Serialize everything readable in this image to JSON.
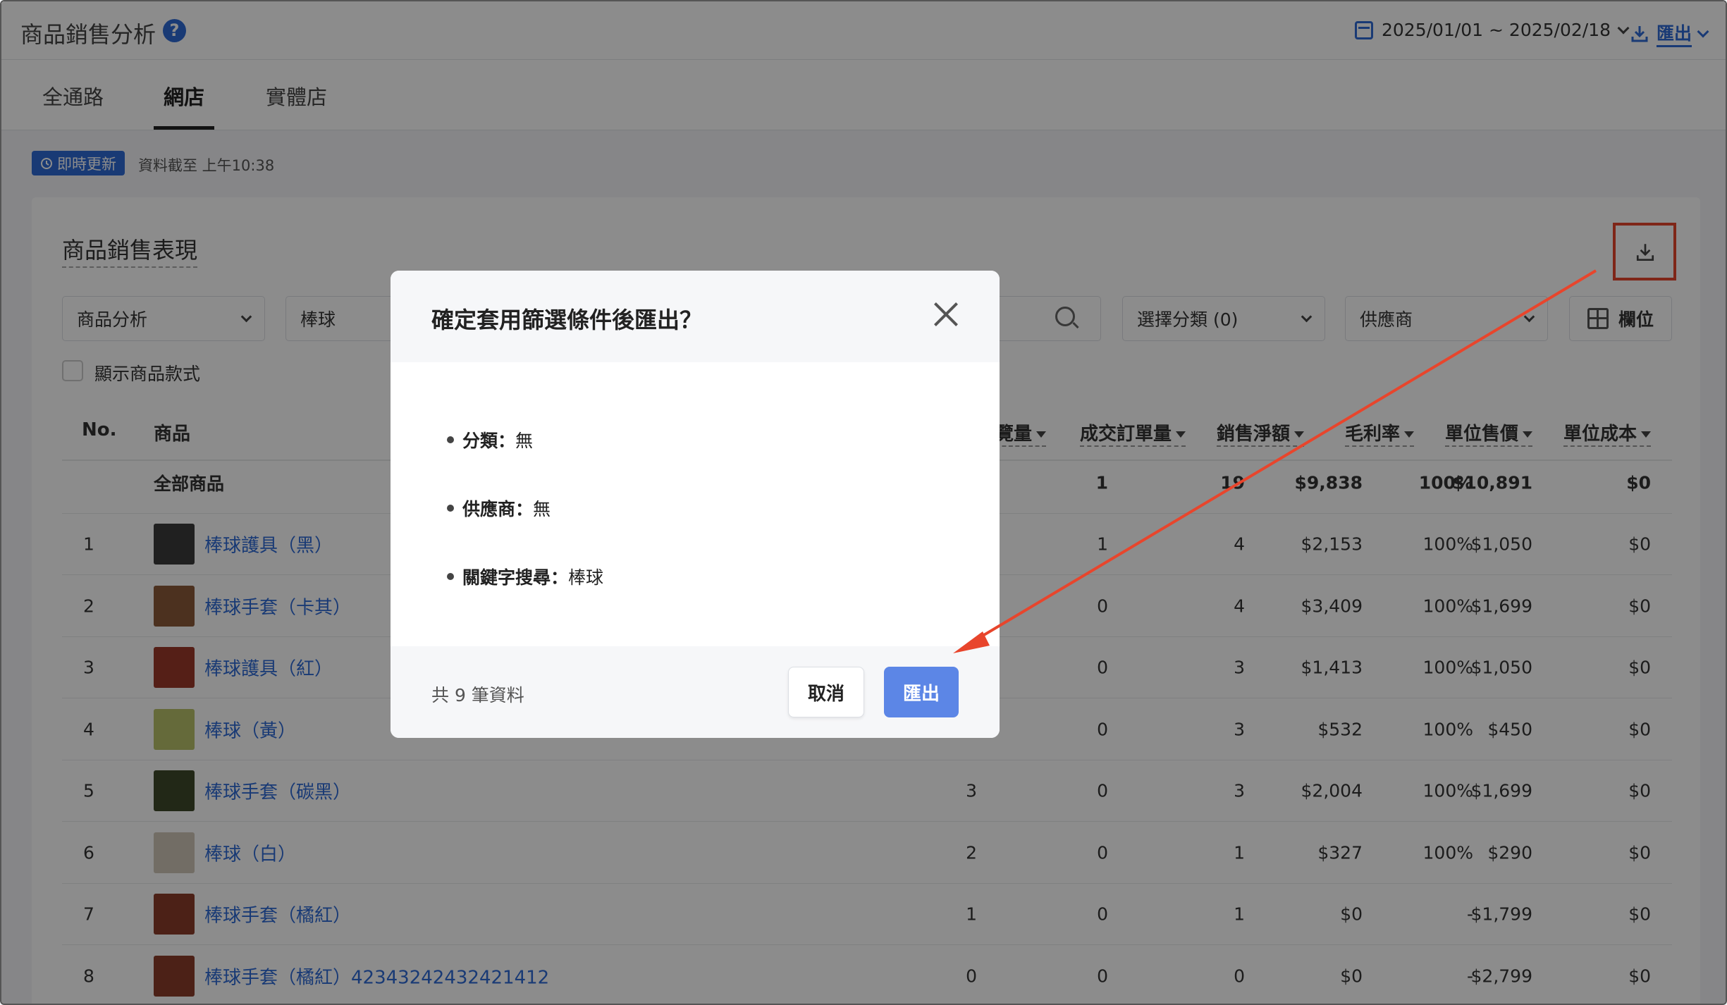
{
  "header": {
    "title": "商品銷售分析",
    "help_icon": "?",
    "date_range": "2025/01/01 ~ 2025/02/18",
    "export_label": "匯出"
  },
  "tabs": [
    {
      "label": "全通路"
    },
    {
      "label": "網店"
    },
    {
      "label": "實體店"
    }
  ],
  "live": {
    "badge": "即時更新",
    "updated_text": "資料截至 上午10:38"
  },
  "card": {
    "title": "商品銷售表現",
    "filters": {
      "analysis_select": "商品分析",
      "keyword_value": "棒球",
      "category_select": "選擇分類 (0)",
      "supplier_select": "供應商",
      "columns_button": "欄位"
    },
    "show_variants_label": "顯示商品款式"
  },
  "table": {
    "headers": {
      "no": "No.",
      "product": "商品",
      "views": "覽量",
      "orders": "成交訂單量",
      "net_sales": "銷售淨額",
      "margin": "毛利率",
      "unit_price": "單位售價",
      "unit_cost": "單位成本"
    },
    "total": {
      "label": "全部商品",
      "views": "1",
      "orders": "19",
      "net_sales": "$9,838",
      "margin": "100%",
      "unit_price": "$10,891",
      "unit_cost": "$0"
    },
    "rows": [
      {
        "no": "1",
        "name": "棒球護具（黑）",
        "a": "",
        "views": "1",
        "orders": "4",
        "net_sales": "$2,153",
        "margin": "100%",
        "unit_price": "$1,050",
        "unit_cost": "$0"
      },
      {
        "no": "2",
        "name": "棒球手套（卡其）",
        "a": "",
        "views": "0",
        "orders": "4",
        "net_sales": "$3,409",
        "margin": "100%",
        "unit_price": "$1,699",
        "unit_cost": "$0"
      },
      {
        "no": "3",
        "name": "棒球護具（紅）",
        "a": "",
        "views": "0",
        "orders": "3",
        "net_sales": "$1,413",
        "margin": "100%",
        "unit_price": "$1,050",
        "unit_cost": "$0"
      },
      {
        "no": "4",
        "name": "棒球（黃）",
        "a": "",
        "views": "0",
        "orders": "3",
        "net_sales": "$532",
        "margin": "100%",
        "unit_price": "$450",
        "unit_cost": "$0"
      },
      {
        "no": "5",
        "name": "棒球手套（碳黑）",
        "a": "3",
        "views": "0",
        "orders": "3",
        "net_sales": "$2,004",
        "margin": "100%",
        "unit_price": "$1,699",
        "unit_cost": "$0"
      },
      {
        "no": "6",
        "name": "棒球（白）",
        "a": "2",
        "views": "0",
        "orders": "1",
        "net_sales": "$327",
        "margin": "100%",
        "unit_price": "$290",
        "unit_cost": "$0"
      },
      {
        "no": "7",
        "name": "棒球手套（橘紅）",
        "a": "1",
        "views": "0",
        "orders": "1",
        "net_sales": "$0",
        "margin": "-",
        "unit_price": "$1,799",
        "unit_cost": "$0"
      },
      {
        "no": "8",
        "name": "棒球手套（橘紅）42343242432421412",
        "a": "0",
        "views": "0",
        "orders": "0",
        "net_sales": "$0",
        "margin": "-",
        "unit_price": "$2,799",
        "unit_cost": "$0"
      }
    ]
  },
  "modal": {
    "title": "確定套用篩選條件後匯出？",
    "filters": [
      {
        "key": "分類：",
        "value": "無"
      },
      {
        "key": "供應商：",
        "value": "無"
      },
      {
        "key": "關鍵字搜尋：",
        "value": "棒球"
      }
    ],
    "count_text": "共 9 筆資料",
    "cancel_label": "取消",
    "export_label": "匯出"
  },
  "colors": {
    "accent": "#2f6bd6",
    "primary_button": "#5c86e6",
    "annotation": "#e8452c"
  }
}
